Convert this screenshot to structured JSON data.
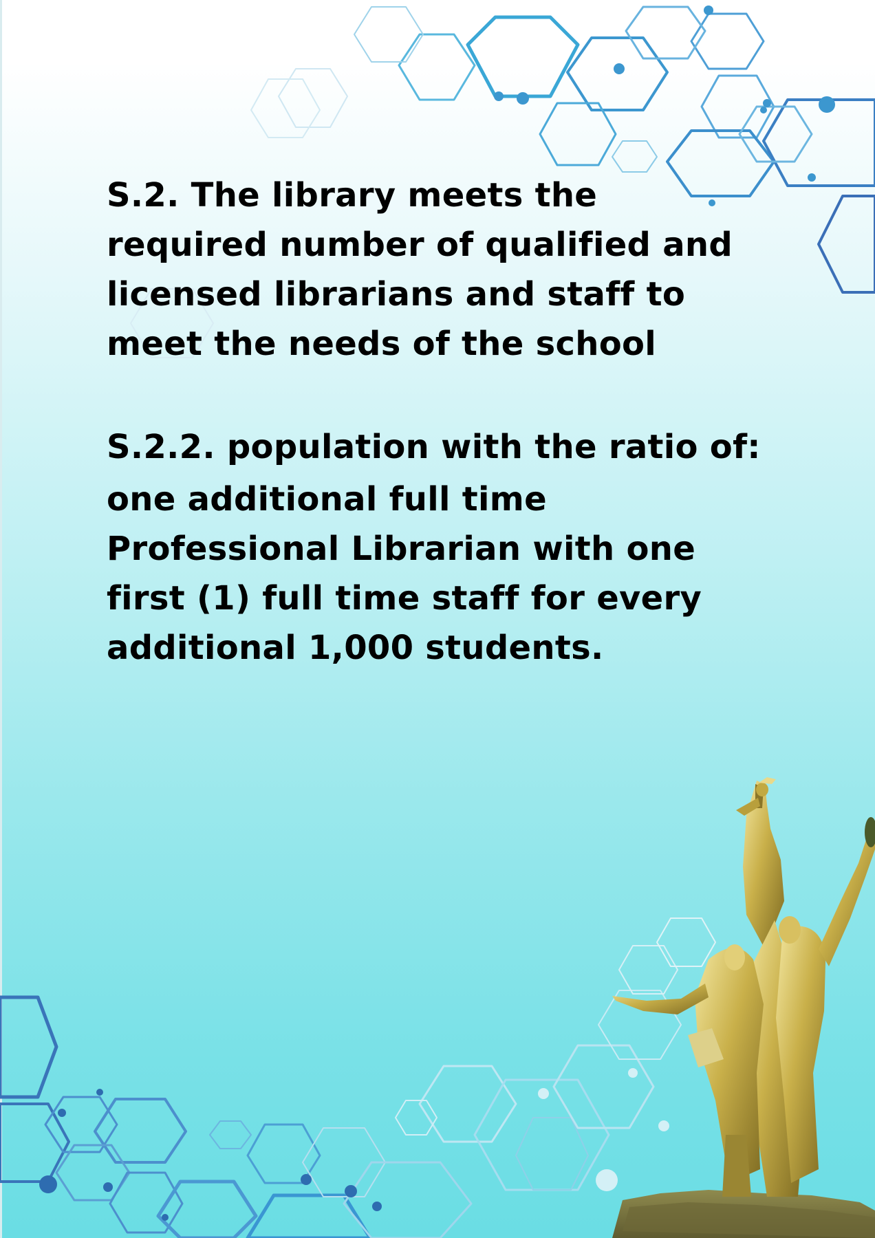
{
  "standard": {
    "heading": "S.2. The library meets the required number of qualified and licensed librarians and staff to meet the needs of the school",
    "subheading": "S.2.2. population with the ratio of:",
    "body": "one additional full time Professional Librarian with one first (1) full time staff for every additional 1,000 students."
  },
  "decor": {
    "hexagon_color": "#3aa7d6",
    "hexagon_dark": "#2f6fb3",
    "monument_color": "#b8a23a"
  }
}
